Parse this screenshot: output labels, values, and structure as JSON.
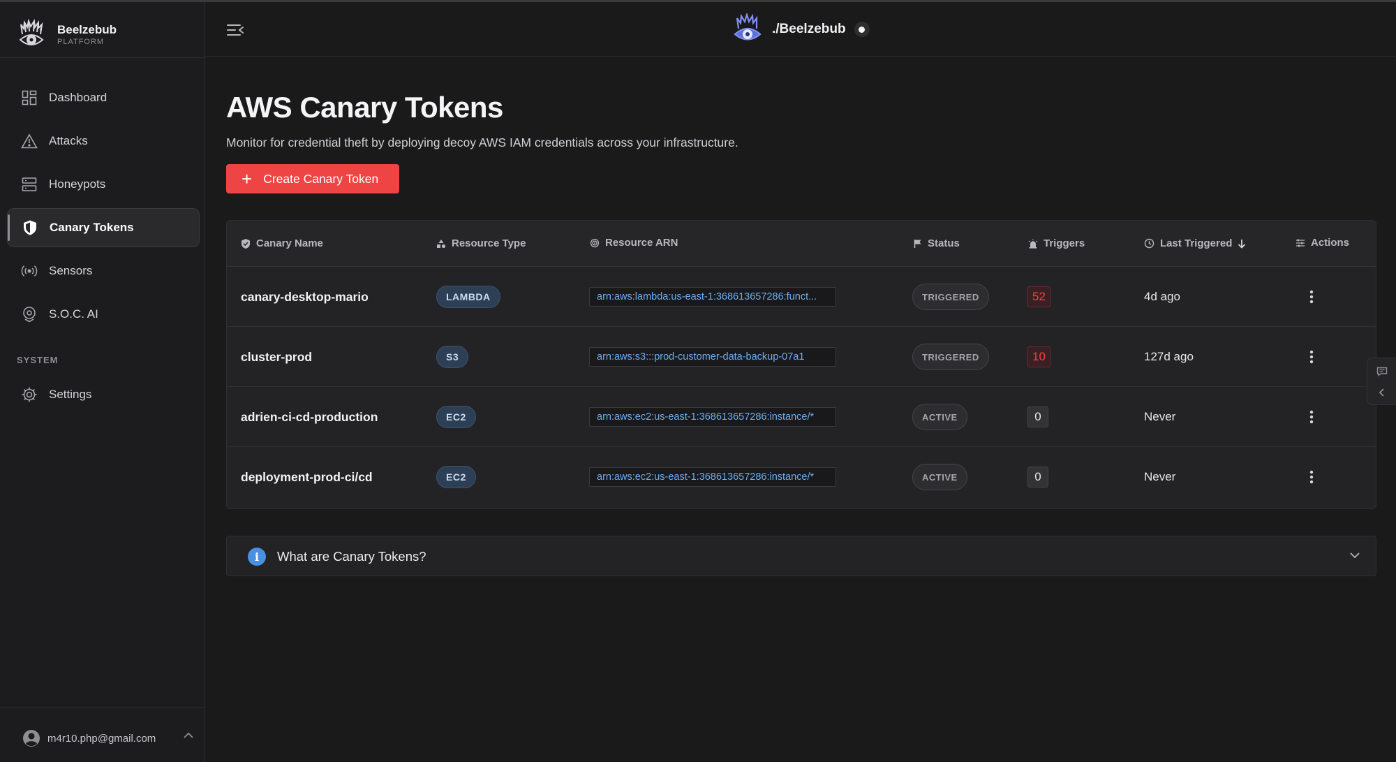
{
  "brand": {
    "name": "Beelzebub",
    "sub": "PLATFORM"
  },
  "header": {
    "title": "./Beelzebub"
  },
  "nav": {
    "items": [
      {
        "label": "Dashboard",
        "icon": "grid-icon"
      },
      {
        "label": "Attacks",
        "icon": "warning-icon"
      },
      {
        "label": "Honeypots",
        "icon": "server-icon"
      },
      {
        "label": "Canary Tokens",
        "icon": "shield-icon",
        "active": true
      },
      {
        "label": "Sensors",
        "icon": "broadcast-icon"
      },
      {
        "label": "S.O.C. AI",
        "icon": "ai-pin-icon"
      }
    ],
    "system_label": "SYSTEM",
    "settings_label": "Settings"
  },
  "user": {
    "email": "m4r10.php@gmail.com"
  },
  "page": {
    "title": "AWS Canary Tokens",
    "description": "Monitor for credential theft by deploying decoy AWS IAM credentials across your infrastructure.",
    "create_button": "Create Canary Token"
  },
  "table": {
    "columns": {
      "name": "Canary Name",
      "type": "Resource Type",
      "arn": "Resource ARN",
      "status": "Status",
      "triggers": "Triggers",
      "last": "Last Triggered",
      "actions": "Actions"
    },
    "rows": [
      {
        "name": "canary-desktop-mario",
        "type": "LAMBDA",
        "arn": "arn:aws:lambda:us-east-1:368613657286:funct...",
        "status": "TRIGGERED",
        "triggers": "52",
        "last": "4d ago"
      },
      {
        "name": "cluster-prod",
        "type": "S3",
        "arn": "arn:aws:s3:::prod-customer-data-backup-07a1",
        "status": "TRIGGERED",
        "triggers": "10",
        "last": "127d ago"
      },
      {
        "name": "adrien-ci-cd-production",
        "type": "EC2",
        "arn": "arn:aws:ec2:us-east-1:368613657286:instance/*",
        "status": "ACTIVE",
        "triggers": "0",
        "last": "Never"
      },
      {
        "name": "deployment-prod-ci/cd",
        "type": "EC2",
        "arn": "arn:aws:ec2:us-east-1:368613657286:instance/*",
        "status": "ACTIVE",
        "triggers": "0",
        "last": "Never"
      }
    ]
  },
  "faq": {
    "title": "What are Canary Tokens?"
  },
  "colors": {
    "accent_red": "#ef4444",
    "info_blue": "#4a90e2",
    "arn_blue": "#6eaef0",
    "background": "#1a1a1b"
  }
}
